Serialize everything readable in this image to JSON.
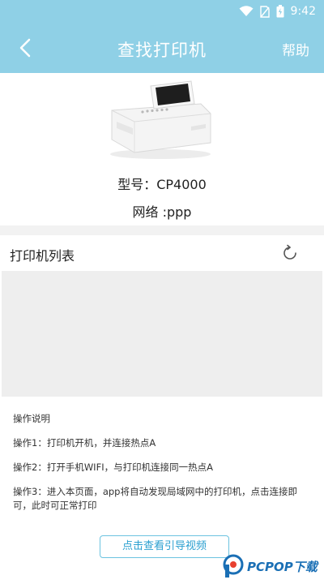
{
  "status_bar": {
    "time": "9:42",
    "icons": [
      "wifi-icon",
      "no-sim-icon",
      "battery-icon"
    ]
  },
  "header": {
    "title": "查找打印机",
    "help_label": "帮助",
    "back_icon": "chevron-left-icon",
    "background_color": "#8fd0e6"
  },
  "printer": {
    "model_text": "型号：CP4000",
    "network_text": "网络 :ppp"
  },
  "printer_list": {
    "title": "打印机列表",
    "refresh_icon": "refresh-icon"
  },
  "instructions": {
    "heading": "操作说明",
    "steps": [
      "操作1：打印机开机，并连接热点A",
      "操作2：打开手机WIFI，与打印机连接同一热点A",
      "操作3：进入本页面，app将自动发现局域网中的打印机，点击连接即可，此时可正常打印"
    ]
  },
  "guide_button": {
    "label": "点击查看引导视频",
    "accent_color": "#6cc3e0"
  },
  "watermark": {
    "text": "PCPOP下载"
  }
}
